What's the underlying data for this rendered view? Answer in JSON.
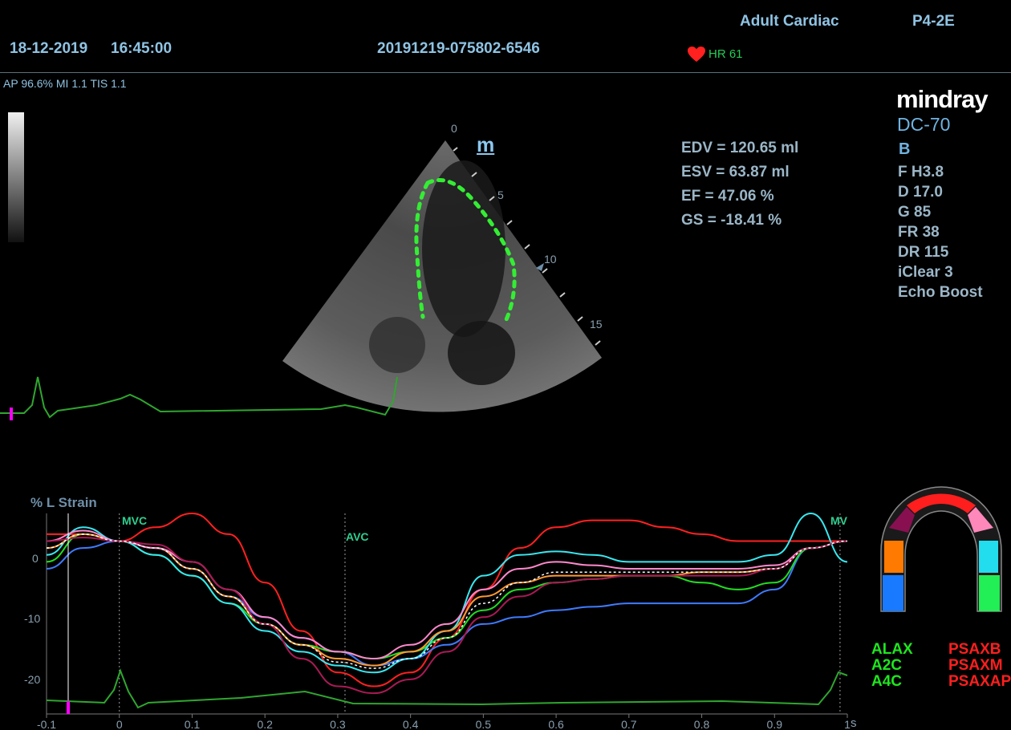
{
  "header": {
    "date": "18-12-2019",
    "time": "16:45:00",
    "study_id": "20191219-075802-6546",
    "exam_preset": "Adult Cardiac",
    "probe": "P4-2E",
    "heart_rate": "HR 61",
    "acoustic_info": "AP 96.6%  MI 1.1 TIS 1.1"
  },
  "brand": {
    "logo": "mindray",
    "model": "DC-70"
  },
  "imaging_params": {
    "mode": "B",
    "items": [
      "F H3.8",
      "D 17.0",
      "G 85",
      "FR 38",
      "DR 115",
      "iClear 3",
      "Echo Boost"
    ]
  },
  "measurements": [
    "EDV = 120.65 ml",
    "ESV = 63.87 ml",
    "EF  = 47.06 %",
    "GS = -18.41 %"
  ],
  "depth_scale": {
    "labels": [
      "0",
      "5",
      "10",
      "15"
    ]
  },
  "sector_marker": "m",
  "strain_plot": {
    "ylabel": "% L Strain",
    "events": [
      "MVC",
      "AVC",
      "MV"
    ],
    "y_ticks": [
      "0",
      "-10",
      "-20"
    ],
    "x_ticks": [
      "-0.1",
      "0",
      "0.1",
      "0.2",
      "0.3",
      "0.4",
      "0.5",
      "0.6",
      "0.7",
      "0.8",
      "0.9",
      "1"
    ],
    "x_unit": "s"
  },
  "segment_legend": {
    "left": [
      "ALAX",
      "A2C",
      "A4C"
    ],
    "right": [
      "PSAXB",
      "PSAXM",
      "PSAXAP"
    ]
  },
  "colors": {
    "trace_green": "#2fa62f",
    "legend_green": "#1ee61e",
    "legend_red": "#ff1e1e",
    "marker_magenta": "#ff00ff",
    "heart_red": "#ff2020"
  },
  "chart_data": {
    "type": "line",
    "ylabel": "% L Strain",
    "xlabel": "s",
    "xlim": [
      -0.1,
      1.0
    ],
    "ylim": [
      -25,
      4
    ],
    "event_markers": [
      {
        "label": "MVC",
        "x": 0.0
      },
      {
        "label": "AVC",
        "x": 0.31
      },
      {
        "label": "MV",
        "x": 0.99
      }
    ],
    "x": [
      -0.1,
      -0.05,
      0.0,
      0.05,
      0.1,
      0.15,
      0.2,
      0.25,
      0.3,
      0.35,
      0.4,
      0.45,
      0.5,
      0.55,
      0.6,
      0.65,
      0.7,
      0.75,
      0.8,
      0.85,
      0.9,
      0.95,
      1.0
    ],
    "series": [
      {
        "color": "#ff2020",
        "values": [
          1,
          1,
          0,
          2,
          4,
          1,
          -6,
          -13,
          -19,
          -21,
          -19,
          -14,
          -7,
          -1,
          2,
          3,
          3,
          2,
          1,
          0,
          0,
          0,
          0
        ]
      },
      {
        "color": "#3f7bff",
        "values": [
          -4,
          -1,
          0,
          -1,
          -4,
          -8,
          -11,
          -14,
          -16,
          -18,
          -17,
          -15,
          -12,
          -11,
          -10,
          -9.5,
          -9,
          -9,
          -9,
          -9,
          -7,
          -1,
          0
        ]
      },
      {
        "color": "#22dd22",
        "values": [
          -3,
          1,
          0,
          -2,
          -5,
          -9,
          -12,
          -15,
          -16,
          -17,
          -16,
          -14,
          -10,
          -7,
          -6,
          -5.5,
          -5,
          -5,
          -6,
          -7,
          -6,
          -1,
          0
        ]
      },
      {
        "color": "#38e8f0",
        "values": [
          -2,
          2,
          0,
          -2,
          -5,
          -9,
          -13,
          -16,
          -18,
          -19,
          -17,
          -13,
          -5,
          -2,
          -1.5,
          -2,
          -3,
          -3,
          -3,
          -3,
          -2,
          4,
          -3
        ]
      },
      {
        "color": "#ff9933",
        "values": [
          -1,
          1,
          0,
          -1,
          -4,
          -8,
          -12,
          -15,
          -17,
          -18,
          -16,
          -13,
          -8,
          -6,
          -5,
          -5,
          -5,
          -5,
          -4.5,
          -4.5,
          -4,
          -1,
          0
        ]
      },
      {
        "color": "#ff88cc",
        "values": [
          0,
          1.5,
          0,
          -1,
          -3,
          -7,
          -11,
          -14,
          -16,
          -17,
          -15,
          -12,
          -7,
          -4,
          -3,
          -3.5,
          -4,
          -4,
          -4,
          -4,
          -3.5,
          -1,
          0
        ]
      },
      {
        "color": "#aa1a55",
        "values": [
          0,
          0.5,
          0,
          -0.5,
          -3,
          -7,
          -12,
          -17,
          -21,
          -22,
          -20,
          -16,
          -11,
          -8,
          -6,
          -5.5,
          -5,
          -5,
          -5,
          -5,
          -4,
          -1,
          0
        ]
      },
      {
        "color": "#ffffff",
        "values": [
          -1,
          1,
          0,
          -1,
          -4,
          -8,
          -12,
          -15,
          -17.5,
          -18.4,
          -17,
          -14,
          -9,
          -6,
          -4.5,
          -4.5,
          -4.5,
          -4.5,
          -4.5,
          -4.5,
          -4,
          -1,
          0
        ]
      }
    ]
  }
}
